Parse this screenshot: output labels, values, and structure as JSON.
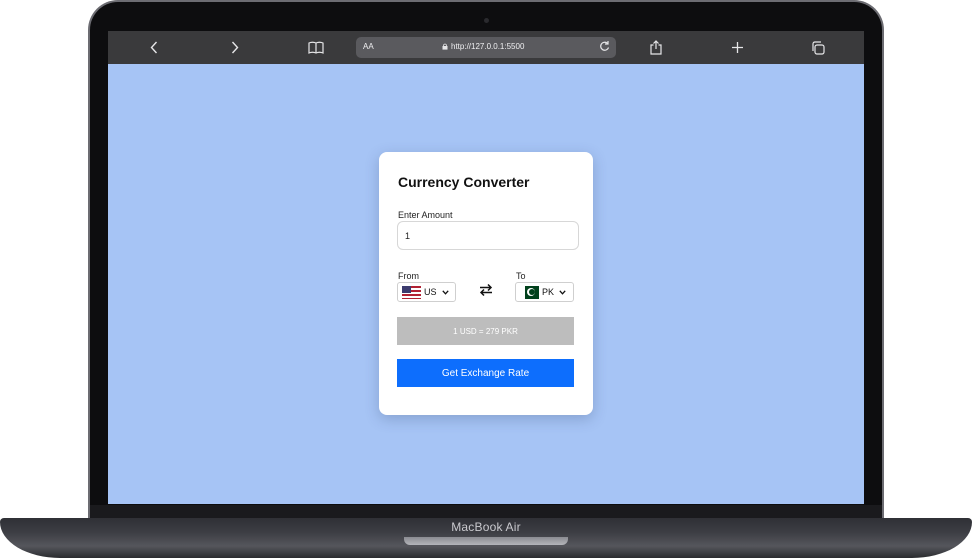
{
  "device": {
    "label": "MacBook Air"
  },
  "browser": {
    "back_icon": "chevron-left-icon",
    "forward_icon": "chevron-right-icon",
    "bookmarks_icon": "book-icon",
    "text_size_label": "AA",
    "url": "http://127.0.0.1:5500",
    "lock_icon": "lock-icon",
    "reload_icon": "reload-icon",
    "share_icon": "share-icon",
    "new_tab_icon": "plus-icon",
    "tabs_icon": "tabs-icon"
  },
  "app": {
    "title": "Currency Converter",
    "amount_label": "Enter Amount",
    "amount_value": "1",
    "from_label": "From",
    "to_label": "To",
    "from_currency": "US",
    "to_currency": "PK",
    "from_flag": "us-flag",
    "to_flag": "pk-flag",
    "swap_icon": "swap-arrows-icon",
    "result_text": "1 USD = 279 PKR",
    "button_label": "Get Exchange Rate"
  },
  "colors": {
    "page_background": "#a6c4f5",
    "button_primary": "#0d6efd",
    "result_background": "#bdbdbd",
    "card_background": "#ffffff"
  }
}
